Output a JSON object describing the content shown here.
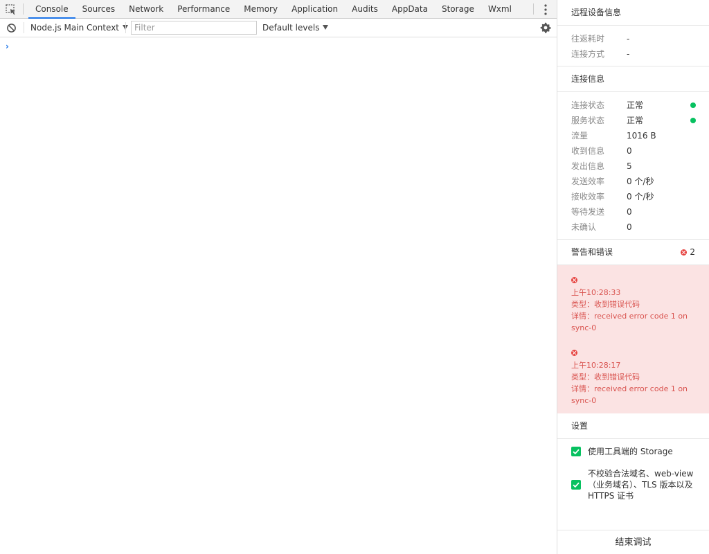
{
  "devtools": {
    "tabs": [
      "Console",
      "Sources",
      "Network",
      "Performance",
      "Memory",
      "Application",
      "Audits",
      "AppData",
      "Storage",
      "Wxml"
    ],
    "active_tab": "Console",
    "context": "Node.js Main Context",
    "filter_placeholder": "Filter",
    "levels": "Default levels",
    "prompt": "›"
  },
  "panel": {
    "remote_title": "远程设备信息",
    "remote": [
      {
        "label": "往返耗时",
        "value": "-"
      },
      {
        "label": "连接方式",
        "value": "-"
      }
    ],
    "conn_title": "连接信息",
    "conn": [
      {
        "label": "连接状态",
        "value": "正常",
        "ok": true
      },
      {
        "label": "服务状态",
        "value": "正常",
        "ok": true
      },
      {
        "label": "流量",
        "value": "1016 B"
      },
      {
        "label": "收到信息",
        "value": "0"
      },
      {
        "label": "发出信息",
        "value": "5"
      },
      {
        "label": "发送效率",
        "value": "0 个/秒"
      },
      {
        "label": "接收效率",
        "value": "0 个/秒"
      },
      {
        "label": "等待发送",
        "value": "0"
      },
      {
        "label": "未确认",
        "value": "0"
      }
    ],
    "warn_title": "警告和错误",
    "warn_count": "2",
    "errors": [
      {
        "time": "上午10:28:33",
        "type": "类型：收到错误代码",
        "detail": "详情：received error code 1 on sync-0"
      },
      {
        "time": "上午10:28:17",
        "type": "类型：收到错误代码",
        "detail": "详情：received error code 1 on sync-0"
      }
    ],
    "settings_title": "设置",
    "settings": [
      {
        "label": "使用工具端的 Storage",
        "checked": true
      },
      {
        "label": "不校验合法域名、web-view（业务域名）、TLS 版本以及 HTTPS 证书",
        "checked": true
      }
    ],
    "end_button": "结束调试"
  },
  "colors": {
    "accent": "#1a73e8",
    "ok": "#07c160",
    "error": "#e64340",
    "error_bg": "#fbe3e3"
  }
}
